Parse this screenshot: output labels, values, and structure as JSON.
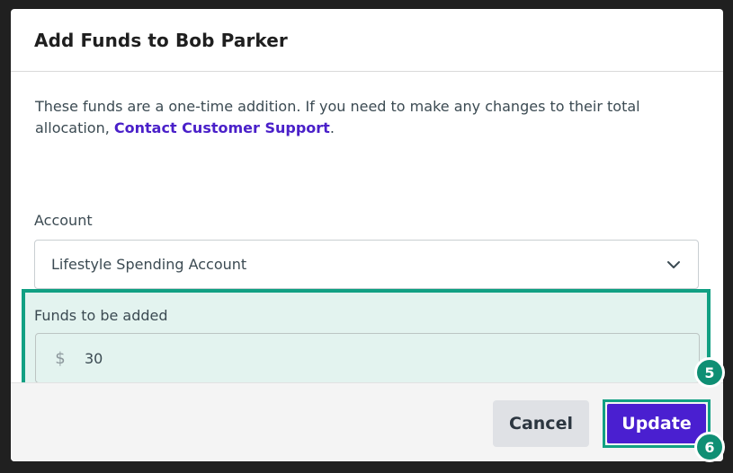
{
  "modal": {
    "title": "Add Funds to Bob Parker",
    "intro_text": "These funds are a one-time addition. If you need to make any changes to their total allocation, ",
    "intro_link": "Contact Customer Support",
    "intro_end": "."
  },
  "account": {
    "label": "Account",
    "selected": "Lifestyle Spending Account"
  },
  "funds": {
    "label": "Funds to be added",
    "currency": "$",
    "value": "30"
  },
  "footer": {
    "cancel_label": "Cancel",
    "update_label": "Update"
  },
  "badges": {
    "funds_step": "5",
    "update_step": "6"
  },
  "colors": {
    "accent": "#4a1fd0",
    "highlight": "#11a083",
    "highlight_bg": "#e3f3ef"
  }
}
